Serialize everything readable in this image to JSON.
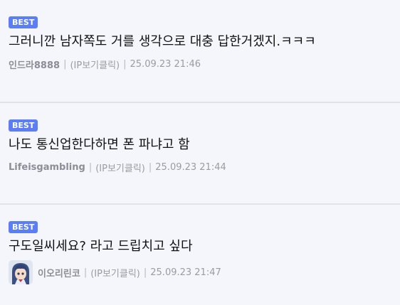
{
  "comments": [
    {
      "badge": "BEST",
      "text": "그러니깐 남자쪽도 거를 생각으로 대충 답한거겠지.ㅋㅋㅋ",
      "author": "인드라8888",
      "ip_note": "(IP보기클릭)",
      "timestamp": "25.09.23 21:46",
      "separator": "|"
    },
    {
      "badge": "BEST",
      "text": "나도 통신업한다하면 폰 파냐고 함",
      "author": "Lifeisgambling",
      "ip_note": "(IP보기클릭)",
      "timestamp": "25.09.23 21:44",
      "separator": "|"
    },
    {
      "badge": "BEST",
      "text": "구도일씨세요? 라고 드립치고 싶다",
      "author": "이오리린코",
      "ip_note": "(IP보기클릭)",
      "timestamp": "25.09.23 21:47",
      "separator": "|",
      "avatar_icon": "anime-character-avatar"
    }
  ],
  "colors": {
    "badge_bg": "#5b7ef5",
    "page_bg": "#f5f6fb",
    "divider": "#e1e3ea"
  }
}
